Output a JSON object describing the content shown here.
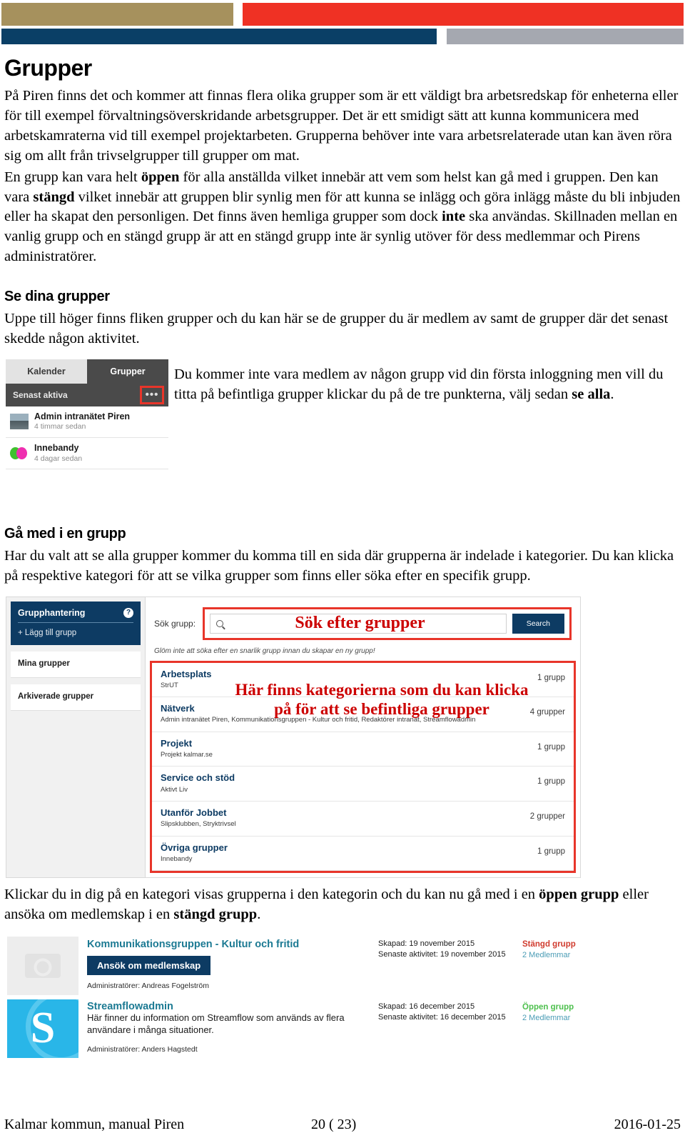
{
  "header_bars": {
    "gold": "#a6915d",
    "red": "#ef3124",
    "navy": "#0a3f66",
    "gray": "#a5a8b0"
  },
  "doc": {
    "title": "Grupper",
    "intro_paragraph": "På Piren finns det och kommer att finnas flera olika grupper som är ett väldigt bra arbetsredskap för enheterna eller för till exempel förvaltningsöverskridande arbetsgrupper. Det är ett smidigt sätt att kunna kommunicera med arbetskamraterna vid till exempel projektarbeten. Grupperna behöver inte vara arbetsrelaterade utan kan även röra sig om allt från trivselgrupper till grupper om mat.",
    "para2_part1": "En grupp kan vara helt ",
    "para2_bold1": "öppen",
    "para2_part2": " för alla anställda vilket innebär att vem som helst kan gå med i gruppen. Den kan vara ",
    "para2_bold2": "stängd",
    "para2_part3": " vilket innebär att gruppen blir synlig men för att kunna se inlägg och göra inlägg måste du bli inbjuden eller ha skapat den personligen. Det finns även hemliga grupper som dock ",
    "para2_bold3": "inte",
    "para2_part4": " ska användas. Skillnaden mellan en vanlig grupp och en stängd grupp är att en stängd grupp inte är synlig utöver för dess medlemmar och Pirens administratörer."
  },
  "section_see": {
    "title": "Se dina grupper",
    "body": "Uppe till höger finns fliken grupper och du kan här se de grupper du är medlem av samt de grupper där det senast skedde någon aktivitet.",
    "side_text_part1": "Du kommer inte vara medlem av någon grupp vid din första inloggning men vill du titta på befintliga grupper klickar du på de tre punkterna, välj sedan ",
    "side_text_bold": "se alla",
    "side_text_part2": "."
  },
  "widget_groups": {
    "tab_calendar": "Kalender",
    "tab_groups": "Grupper",
    "subheader": "Senast aktiva",
    "more_dots": "•••",
    "items": [
      {
        "name": "Admin intranätet Piren",
        "time": "4 timmar sedan",
        "thumb": "photo-thumbnail"
      },
      {
        "name": "Innebandy",
        "time": "4 dagar sedan",
        "thumb": "balls-thumbnail"
      }
    ]
  },
  "section_join": {
    "title": "Gå med i en grupp",
    "body": "Har du valt att se alla grupper kommer du komma till en sida där grupperna är indelade i kategorier. Du kan klicka på respektive kategori för att se vilka grupper som finns eller söka efter en specifik grupp."
  },
  "group_admin_screenshot": {
    "sidebar": {
      "panel_title": "Grupphantering",
      "help_icon": "?",
      "add_group": "+ Lägg till grupp",
      "items": [
        {
          "label": "Mina grupper"
        },
        {
          "label": "Arkiverade grupper"
        }
      ]
    },
    "search": {
      "label": "Sök grupp:",
      "input_value": "",
      "input_placeholder": "",
      "button_label": "Search",
      "annotation": "Sök efter grupper",
      "hint": "Glöm inte att söka efter en snarlik grupp innan du skapar en ny grupp!"
    },
    "categories_annotation": "Här finns kategorierna som du kan klicka på för att se befintliga grupper",
    "categories": [
      {
        "name": "Arbetsplats",
        "groups": "StrUT",
        "count": "1 grupp"
      },
      {
        "name": "Nätverk",
        "groups": "Admin intranätet Piren, Kommunikationsgruppen - Kultur och fritid, Redaktörer intranät, Streamflowadmin",
        "count": "4 grupper"
      },
      {
        "name": "Projekt",
        "groups": "Projekt kalmar.se",
        "count": "1 grupp"
      },
      {
        "name": "Service och stöd",
        "groups": "Aktivt Liv",
        "count": "1 grupp"
      },
      {
        "name": "Utanför Jobbet",
        "groups": "Slipsklubben, Stryktrivsel",
        "count": "2 grupper"
      },
      {
        "name": "Övriga grupper",
        "groups": "Innebandy",
        "count": "1 grupp"
      }
    ]
  },
  "para_after_categories": {
    "part1": "Klickar du in dig på en kategori visas grupperna i den kategorin och du kan nu gå med i en ",
    "bold1": "öppen grupp",
    "part2": " eller ansöka om medlemskap i en ",
    "bold2": "stängd grupp",
    "part3": "."
  },
  "group_results": [
    {
      "avatar": "camera-placeholder-icon",
      "title": "Kommunikationsgruppen - Kultur och fritid",
      "description": "",
      "button_label": "Ansök om medlemskap",
      "admins": "Administratörer: Andreas Fogelström",
      "created": "Skapad: 19 november 2015",
      "last_activity": "Senaste aktivitet: 19 november 2015",
      "status": "Stängd grupp",
      "status_color": "#d03b2e",
      "members": "2 Medlemmar"
    },
    {
      "avatar": "streamflow-s-logo",
      "avatar_letter": "S",
      "title": "Streamflowadmin",
      "description": "Här finner du information om Streamflow som används av flera användare i många situationer.",
      "button_label": "",
      "admins": "Administratörer: Anders Hagstedt",
      "created": "Skapad: 16 december 2015",
      "last_activity": "Senaste aktivitet: 16 december 2015",
      "status": "Öppen grupp",
      "status_color": "#4ec04e",
      "members": "2 Medlemmar"
    }
  ],
  "footer": {
    "left": "Kalmar kommun, manual Piren",
    "center": "20 ( 23)",
    "right": "2016-01-25"
  }
}
